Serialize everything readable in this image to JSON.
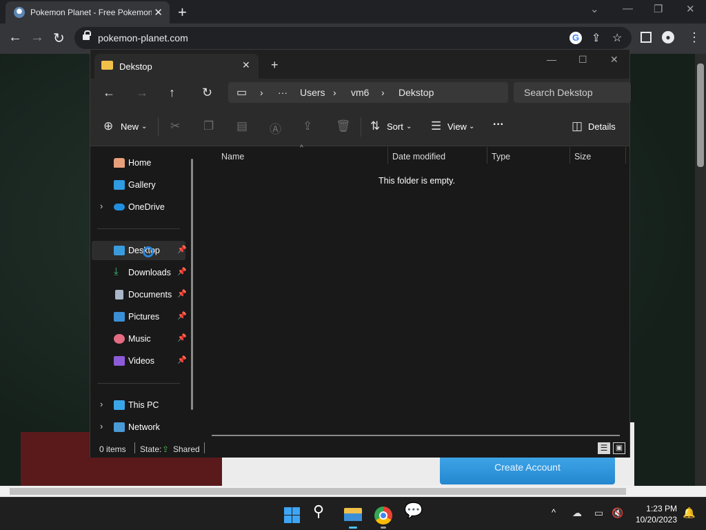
{
  "browser": {
    "tab_title": "Pokemon Planet - Free Pokemon",
    "url": "pokemon-planet.com"
  },
  "webpage": {
    "create_account_label": "Create Account"
  },
  "explorer": {
    "tab_title": "Dekstop",
    "breadcrumb": {
      "more": "···",
      "items": [
        "Users",
        "vm6",
        "Dekstop"
      ]
    },
    "search_placeholder": "Search Dekstop",
    "commands": {
      "new": "New",
      "sort": "Sort",
      "view": "View",
      "more": "···",
      "details": "Details"
    },
    "nav": {
      "home": "Home",
      "gallery": "Gallery",
      "onedrive": "OneDrive",
      "desktop": "Desktop",
      "downloads": "Downloads",
      "documents": "Documents",
      "pictures": "Pictures",
      "music": "Music",
      "videos": "Videos",
      "this_pc": "This PC",
      "network": "Network"
    },
    "columns": {
      "name": "Name",
      "date_modified": "Date modified",
      "type": "Type",
      "size": "Size"
    },
    "empty_message": "This folder is empty.",
    "status": {
      "items": "0 items",
      "state_label": "State:",
      "state_value": "Shared"
    }
  },
  "taskbar": {
    "time": "1:23 PM",
    "date": "10/20/2023"
  },
  "colors": {
    "folder_yellow": "#f0c04a",
    "create_account_blue": "#2487cf",
    "explorer_bg": "#191919"
  }
}
